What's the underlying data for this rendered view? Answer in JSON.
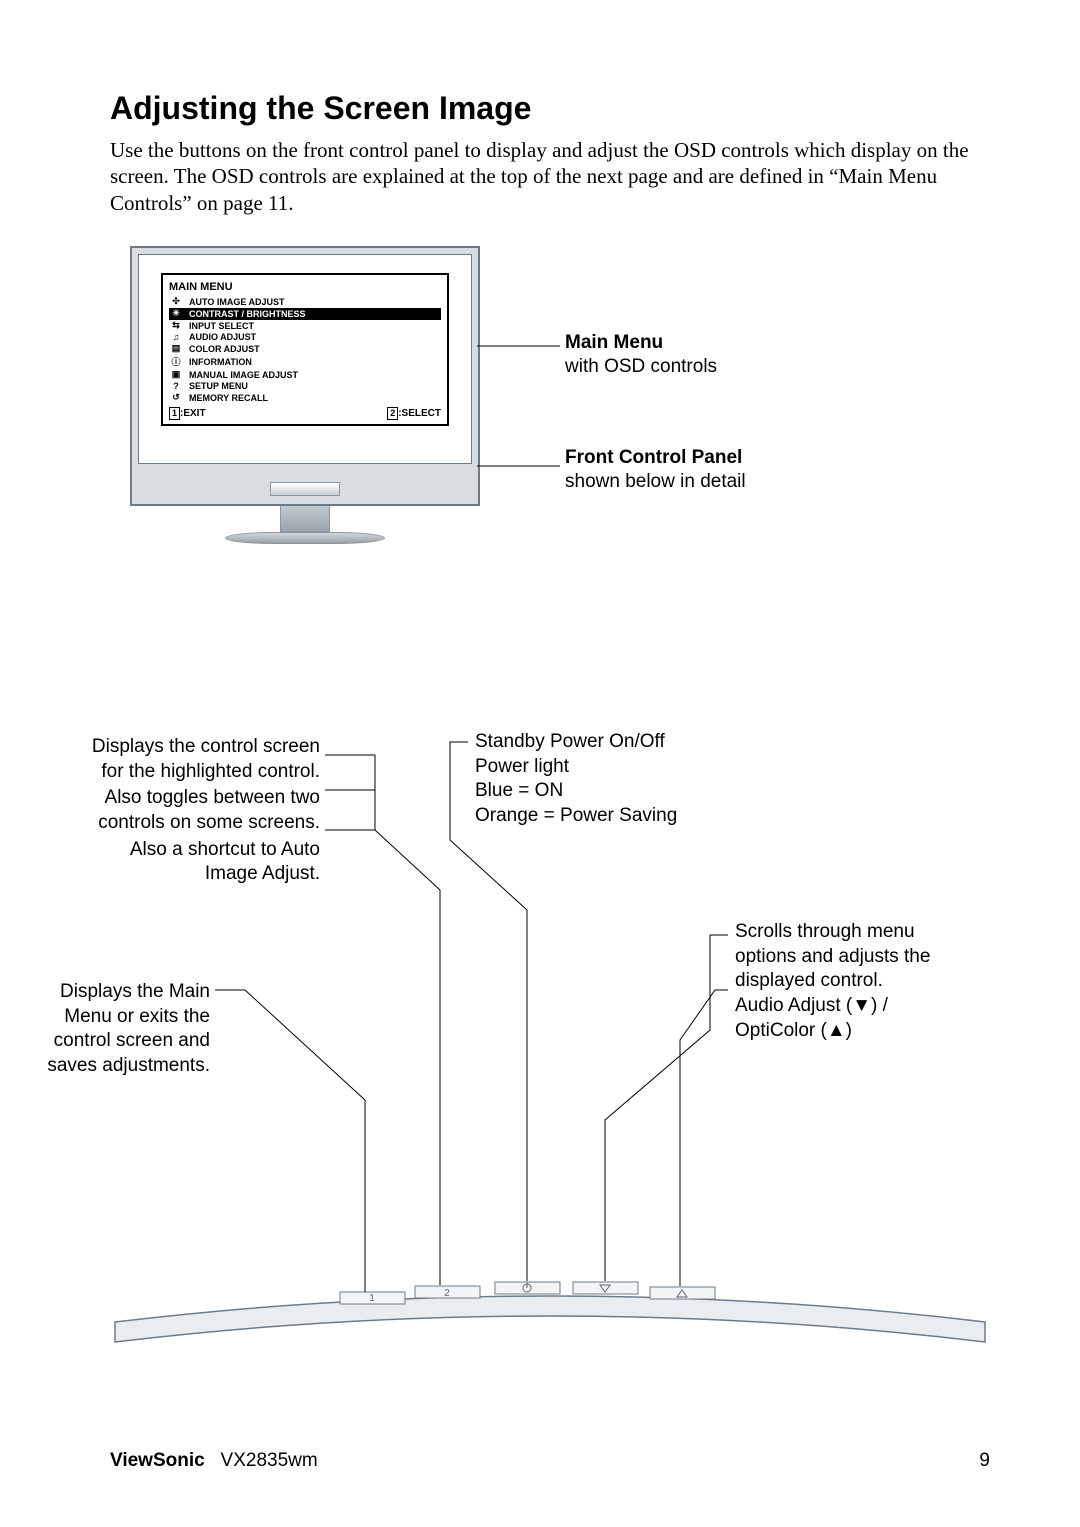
{
  "heading": "Adjusting the Screen Image",
  "intro": "Use the buttons on the front control panel to display and adjust the OSD controls which display on the screen. The OSD controls are explained at the top of the next page and are defined in “Main Menu Controls” on page 11.",
  "osd": {
    "title": "MAIN MENU",
    "items": [
      {
        "icon": "✣",
        "label": "AUTO IMAGE ADJUST",
        "selected": false
      },
      {
        "icon": "☀",
        "label": "CONTRAST / BRIGHTNESS",
        "selected": true
      },
      {
        "icon": "⇆",
        "label": "INPUT SELECT",
        "selected": false
      },
      {
        "icon": "♫",
        "label": "AUDIO ADJUST",
        "selected": false
      },
      {
        "icon": "▤",
        "label": "COLOR ADJUST",
        "selected": false
      },
      {
        "icon": "ⓘ",
        "label": "INFORMATION",
        "selected": false
      },
      {
        "icon": "▣",
        "label": "MANUAL IMAGE ADJUST",
        "selected": false
      },
      {
        "icon": "?",
        "label": "SETUP MENU",
        "selected": false
      },
      {
        "icon": "↺",
        "label": "MEMORY RECALL",
        "selected": false
      }
    ],
    "footer": {
      "exit_key": "1",
      "exit_label": ":EXIT",
      "select_key": "2",
      "select_label": ":SELECT"
    }
  },
  "labels": {
    "main_menu": {
      "title": "Main Menu",
      "sub": "with OSD controls"
    },
    "front_panel": {
      "title": "Front Control Panel",
      "sub": "shown below in detail"
    }
  },
  "callouts": {
    "left1a": "Displays the control screen for the highlighted control.",
    "left1b": "Also toggles between two controls on some screens.",
    "left1c": "Also a shortcut to Auto Image Adjust.",
    "left2": "Displays the Main Menu or exits the control screen and saves adjustments.",
    "right_top1": "Standby Power On/Off",
    "right_top2": "Power light",
    "right_top3": "Blue = ON",
    "right_top4": "Orange = Power Saving",
    "right_mid1": "Scrolls through menu options and adjusts the displayed control.",
    "right_mid2": "Audio Adjust (▼) / OptiColor  (▲)"
  },
  "footer": {
    "brand": "ViewSonic",
    "model": "VX2835wm",
    "page": "9"
  }
}
